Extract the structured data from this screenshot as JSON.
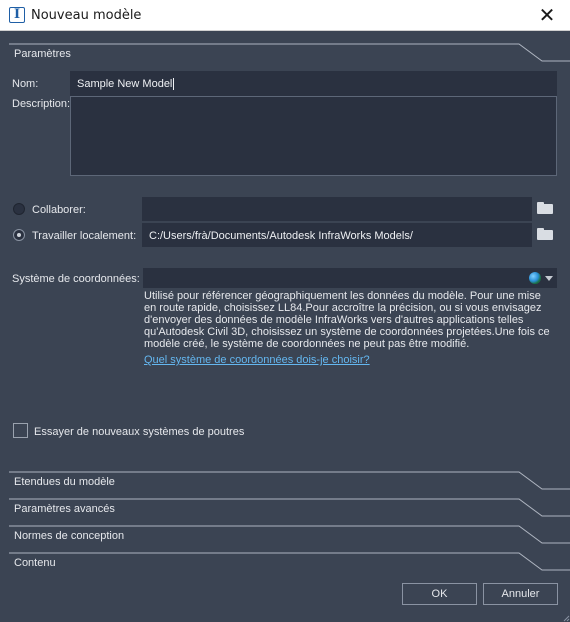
{
  "window": {
    "title": "Nouveau modèle",
    "app_icon_glyph": "I"
  },
  "sections": {
    "parametres": "Paramètres",
    "etendues": "Etendues du modèle",
    "avances": "Paramètres avancés",
    "normes": "Normes de conception",
    "contenu": "Contenu"
  },
  "form": {
    "nom_label": "Nom:",
    "nom_value": "Sample New Model",
    "description_label": "Description:",
    "description_value": "",
    "collaborer_label": "Collaborer:",
    "collaborer_value": "",
    "local_label": "Travailler localement:",
    "local_value": "C:/Users/frà/Documents/Autodesk InfraWorks Models/",
    "coord_label": "Système de coordonnées:",
    "coord_value": "",
    "coord_help": "Utilisé pour référencer géographiquement les données du modèle. Pour une mise en route rapide, choisissez LL84.Pour accroître la précision, ou si vous envisagez d'envoyer des données de modèle InfraWorks vers d'autres applications telles qu'Autodesk Civil 3D, choisissez un système de coordonnées projetées.Une fois ce modèle créé, le système de coordonnées ne peut pas être modifié.",
    "coord_link": "Quel système de coordonnées dois-je choisir?",
    "poutres_label": "Essayer de nouveaux systèmes de poutres",
    "poutres_checked": false,
    "selected_storage": "local"
  },
  "buttons": {
    "ok": "OK",
    "cancel": "Annuler"
  },
  "colors": {
    "background": "#3b4453",
    "field": "#2a3140",
    "link": "#64b7f0",
    "text": "#e6e8ec"
  }
}
